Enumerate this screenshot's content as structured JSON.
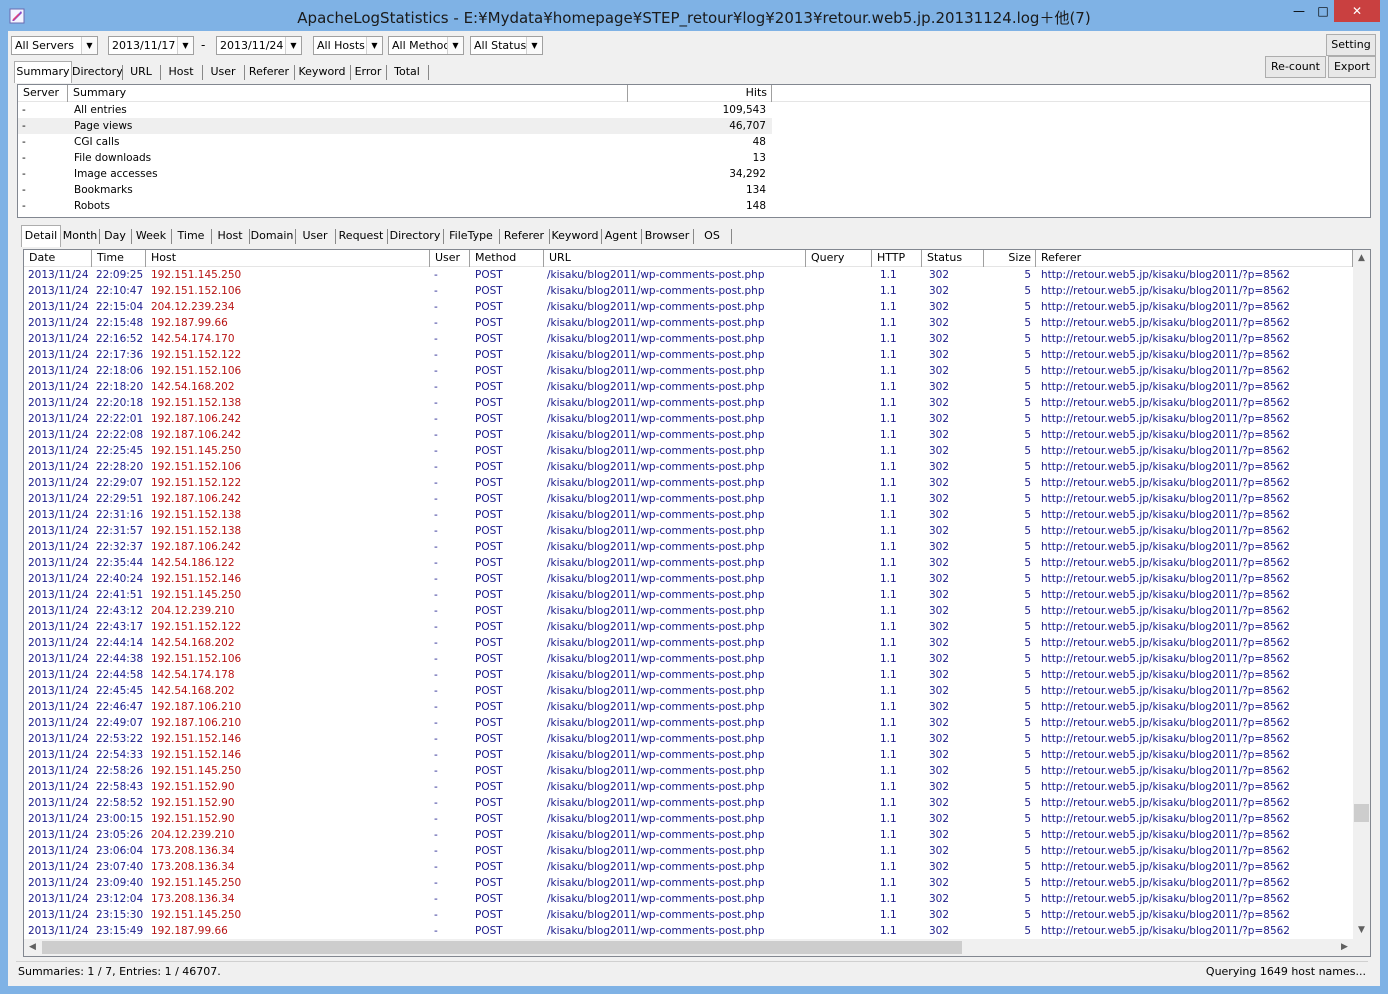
{
  "window": {
    "title": "ApacheLogStatistics - E:¥Mydata¥homepage¥STEP_retour¥log¥2013¥retour.web5.jp.20131124.log＋他(7)",
    "icon": "app-feather-icon",
    "minimize": "—",
    "maximize": "□",
    "close": "✕"
  },
  "filters": {
    "servers": "All Servers",
    "date_from": "2013/11/17",
    "date_sep": "-",
    "date_to": "2013/11/24",
    "hosts": "All Hosts",
    "method": "All Method",
    "status": "All Status"
  },
  "buttons": {
    "setting": "Setting",
    "recount": "Re-count",
    "export": "Export"
  },
  "summary_tabs": [
    "Summary",
    "Directory",
    "URL",
    "Host",
    "User",
    "Referer",
    "Keyword",
    "Error",
    "Total"
  ],
  "summary_table": {
    "headers": [
      "Server",
      "Summary",
      "Hits"
    ],
    "rows": [
      [
        "-",
        "All entries",
        "109,543"
      ],
      [
        "-",
        "Page views",
        "46,707"
      ],
      [
        "-",
        "CGI calls",
        "48"
      ],
      [
        "-",
        "File downloads",
        "13"
      ],
      [
        "-",
        "Image accesses",
        "34,292"
      ],
      [
        "-",
        "Bookmarks",
        "134"
      ],
      [
        "-",
        "Robots",
        "148"
      ]
    ],
    "selected_row": 1
  },
  "detail_tabs": [
    "Detail",
    "Month",
    "Day",
    "Week",
    "Time",
    "Host",
    "Domain",
    "User",
    "Request",
    "Directory",
    "FileType",
    "Referer",
    "Keyword",
    "Agent",
    "Browser",
    "OS"
  ],
  "detail_table": {
    "headers": [
      "Date",
      "Time",
      "Host",
      "User",
      "Method",
      "URL",
      "Query",
      "HTTP",
      "Status",
      "Size",
      "Referer"
    ],
    "common": {
      "date": "2013/11/24",
      "user": "-",
      "method": "POST",
      "url": "/kisaku/blog2011/wp-comments-post.php",
      "http": "1.1",
      "status": "302",
      "size": "5",
      "referer": "http://retour.web5.jp/kisaku/blog2011/?p=8562"
    },
    "rows": [
      [
        "22:09:25",
        "192.151.145.250"
      ],
      [
        "22:10:47",
        "192.151.152.106"
      ],
      [
        "22:15:04",
        "204.12.239.234"
      ],
      [
        "22:15:48",
        "192.187.99.66"
      ],
      [
        "22:16:52",
        "142.54.174.170"
      ],
      [
        "22:17:36",
        "192.151.152.122"
      ],
      [
        "22:18:06",
        "192.151.152.106"
      ],
      [
        "22:18:20",
        "142.54.168.202"
      ],
      [
        "22:20:18",
        "192.151.152.138"
      ],
      [
        "22:22:01",
        "192.187.106.242"
      ],
      [
        "22:22:08",
        "192.187.106.242"
      ],
      [
        "22:25:45",
        "192.151.145.250"
      ],
      [
        "22:28:20",
        "192.151.152.106"
      ],
      [
        "22:29:07",
        "192.151.152.122"
      ],
      [
        "22:29:51",
        "192.187.106.242"
      ],
      [
        "22:31:16",
        "192.151.152.138"
      ],
      [
        "22:31:57",
        "192.151.152.138"
      ],
      [
        "22:32:37",
        "192.187.106.242"
      ],
      [
        "22:35:44",
        "142.54.186.122"
      ],
      [
        "22:40:24",
        "192.151.152.146"
      ],
      [
        "22:41:51",
        "192.151.145.250"
      ],
      [
        "22:43:12",
        "204.12.239.210"
      ],
      [
        "22:43:17",
        "192.151.152.122"
      ],
      [
        "22:44:14",
        "142.54.168.202"
      ],
      [
        "22:44:38",
        "192.151.152.106"
      ],
      [
        "22:44:58",
        "142.54.174.178"
      ],
      [
        "22:45:45",
        "142.54.168.202"
      ],
      [
        "22:46:47",
        "192.187.106.210"
      ],
      [
        "22:49:07",
        "192.187.106.210"
      ],
      [
        "22:53:22",
        "192.151.152.146"
      ],
      [
        "22:54:33",
        "192.151.152.146"
      ],
      [
        "22:58:26",
        "192.151.145.250"
      ],
      [
        "22:58:43",
        "192.151.152.90"
      ],
      [
        "22:58:52",
        "192.151.152.90"
      ],
      [
        "23:00:15",
        "192.151.152.90"
      ],
      [
        "23:05:26",
        "204.12.239.210"
      ],
      [
        "23:06:04",
        "173.208.136.34"
      ],
      [
        "23:07:40",
        "173.208.136.34"
      ],
      [
        "23:09:40",
        "192.151.145.250"
      ],
      [
        "23:12:04",
        "173.208.136.34"
      ],
      [
        "23:15:30",
        "192.151.145.250"
      ],
      [
        "23:15:49",
        "192.187.99.66"
      ]
    ]
  },
  "status_bar": {
    "left": "Summaries: 1 / 7,  Entries: 1 / 46707.",
    "right": "Querying 1649 host names..."
  },
  "colors": {
    "host_text": "#b81414",
    "value_text": "#1c1c8c",
    "close_button": "#c94040"
  }
}
